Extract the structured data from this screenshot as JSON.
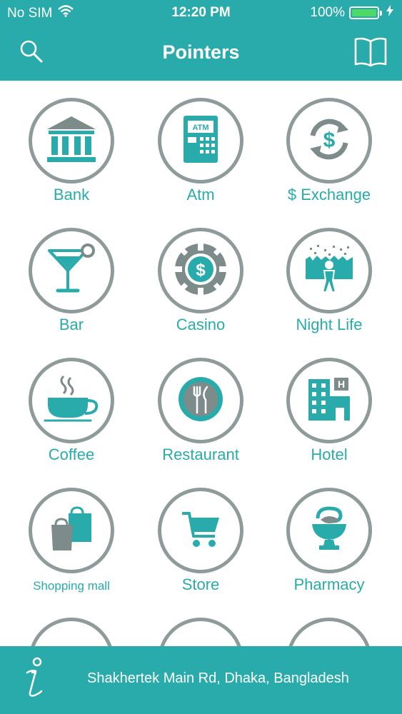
{
  "status": {
    "carrier": "No SIM",
    "time": "12:20 PM",
    "battery": "100%",
    "icons": [
      "wifi-icon",
      "battery-icon",
      "charging-bolt-icon"
    ]
  },
  "nav": {
    "title": "Pointers",
    "left_icon": "search-icon",
    "right_icon": "book-icon"
  },
  "categories": [
    {
      "label": "Bank",
      "icon": "bank-icon"
    },
    {
      "label": "Atm",
      "icon": "atm-icon"
    },
    {
      "label": "$ Exchange",
      "icon": "currency-exchange-icon"
    },
    {
      "label": "Bar",
      "icon": "cocktail-icon"
    },
    {
      "label": "Casino",
      "icon": "casino-chip-icon"
    },
    {
      "label": "Night Life",
      "icon": "night-life-icon"
    },
    {
      "label": "Coffee",
      "icon": "coffee-cup-icon"
    },
    {
      "label": "Restaurant",
      "icon": "restaurant-icon"
    },
    {
      "label": "Hotel",
      "icon": "hotel-icon"
    },
    {
      "label": "Shopping mall",
      "icon": "shopping-bags-icon"
    },
    {
      "label": "Store",
      "icon": "shopping-cart-icon"
    },
    {
      "label": "Pharmacy",
      "icon": "pharmacy-icon"
    }
  ],
  "footer": {
    "info_icon": "info-icon",
    "address": "Shakhertek Main Rd, Dhaka, Bangladesh"
  },
  "colors": {
    "primary": "#2aabab",
    "circle_border": "#8f9a9a",
    "icon_gray": "#7d8b8b",
    "battery_green": "#4cd964"
  }
}
